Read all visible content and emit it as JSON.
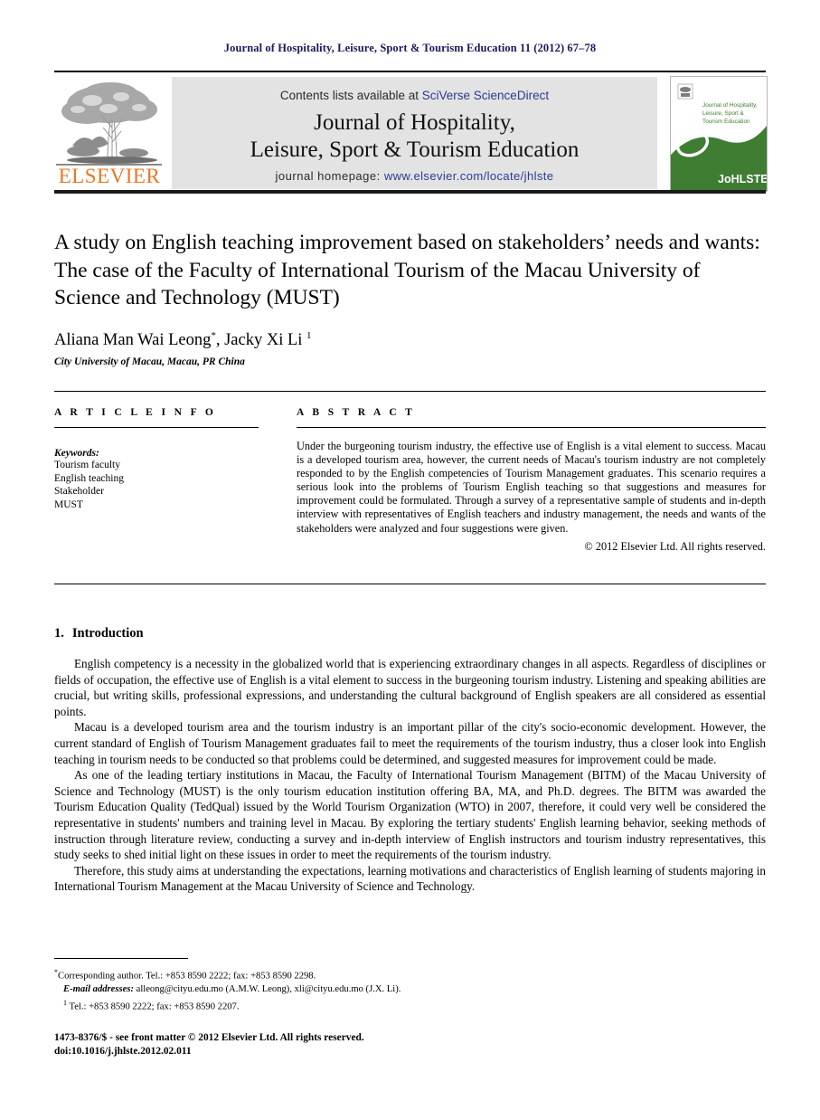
{
  "running_head": "Journal of Hospitality, Leisure, Sport & Tourism Education 11 (2012) 67–78",
  "masthead": {
    "contents_prefix": "Contents lists available at ",
    "sciencedirect": "SciVerse ScienceDirect",
    "journal_title_line1": "Journal of Hospitality,",
    "journal_title_line2": "Leisure, Sport & Tourism Education",
    "homepage_label": "journal homepage: ",
    "homepage_url": "www.elsevier.com/locate/jhlste",
    "publisher": "ELSEVIER",
    "cover": {
      "title_line1": "Journal of Hospitality,",
      "title_line2": "Leisure, Sport &",
      "title_line3": "Tourism Education",
      "abbrev": "JoHLSTE"
    },
    "colors": {
      "link_blue": "#2b3a8f",
      "elsevier_orange": "#e87722",
      "cover_green": "#3f7d33",
      "banner_gray": "#e3e3e3"
    }
  },
  "article": {
    "title": "A study on English teaching improvement based on stakeholders’ needs and wants: The case of the Faculty of International Tourism of the Macau University of Science and Technology (MUST)",
    "authors": "Aliana Man Wai Leong",
    "author_marker_1": "*",
    "authors_2": ", Jacky Xi Li ",
    "author_marker_2": "1",
    "affiliation": "City University of Macau, Macau, PR China"
  },
  "info": {
    "heading": "A R T I C L E   I N F O",
    "keywords_label": "Keywords:",
    "keywords": [
      "Tourism faculty",
      "English teaching",
      "Stakeholder",
      "MUST"
    ]
  },
  "abstract": {
    "heading": "A B S T R A C T",
    "text": "Under the burgeoning tourism industry, the effective use of English is a vital element to success. Macau is a developed tourism area, however, the current needs of Macau's tourism industry are not completely responded to by the English competencies of Tourism Management graduates. This scenario requires a serious look into the problems of Tourism English teaching so that suggestions and measures for improvement could be formulated. Through a survey of a representative sample of students and in-depth interview with representatives of English teachers and industry management, the needs and wants of the stakeholders were analyzed and four suggestions were given.",
    "copyright": "© 2012 Elsevier Ltd. All rights reserved."
  },
  "introduction": {
    "number": "1.",
    "heading": "Introduction",
    "paragraphs": [
      "English competency is a necessity in the globalized world that is experiencing extraordinary changes in all aspects. Regardless of disciplines or fields of occupation, the effective use of English is a vital element to success in the burgeoning tourism industry. Listening and speaking abilities are crucial, but writing skills, professional expressions, and understanding the cultural background of English speakers are all considered as essential points.",
      "Macau is a developed tourism area and the tourism industry is an important pillar of the city's socio-economic development. However, the current standard of English of Tourism Management graduates fail to meet the requirements of the tourism industry, thus a closer look into English teaching in tourism needs to be conducted so that problems could be determined, and suggested measures for improvement could be made.",
      "As one of the leading tertiary institutions in Macau, the Faculty of International Tourism Management (BITM) of the Macau University of Science and Technology (MUST) is the only tourism education institution offering BA, MA, and Ph.D. degrees. The BITM was awarded the Tourism Education Quality (TedQual) issued by the World Tourism Organization (WTO) in 2007, therefore, it could very well be considered the representative in students' numbers and training level in Macau. By exploring the tertiary students' English learning behavior, seeking methods of instruction through literature review, conducting a survey and in-depth interview of English instructors and tourism industry representatives, this study seeks to shed initial light on these issues in order to meet the requirements of the tourism industry.",
      "Therefore, this study aims at understanding the expectations, learning motivations and characteristics of English learning of students majoring in International Tourism Management at the Macau University of Science and Technology."
    ]
  },
  "footnotes": {
    "corresponding": "Corresponding author. Tel.: +853 8590 2222; fax: +853 8590 2298.",
    "email_label": "E-mail addresses:",
    "emails": " alleong@cityu.edu.mo (A.M.W. Leong), xli@cityu.edu.mo (J.X. Li).",
    "tel_marker": "1",
    "tel": " Tel.: +853 8590 2222; fax: +853 8590 2207."
  },
  "colophon": {
    "issn_line": "1473-8376/$ - see front matter © 2012 Elsevier Ltd. All rights reserved.",
    "doi_line": "doi:10.1016/j.jhlste.2012.02.011"
  }
}
